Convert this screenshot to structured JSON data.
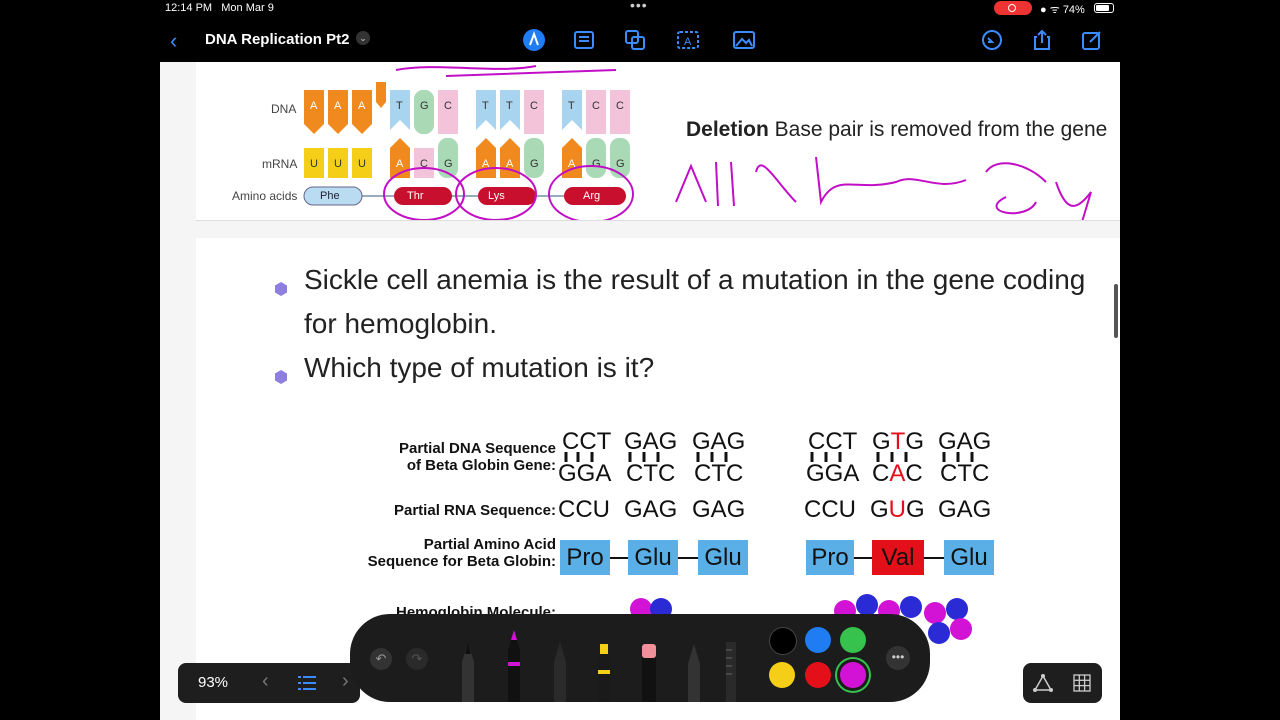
{
  "status": {
    "time": "12:14 PM",
    "date": "Mon Mar 9",
    "battery": "74%"
  },
  "toolbar": {
    "title": "DNA Replication Pt2"
  },
  "slide1": {
    "dna_label": "DNA",
    "mrna_label": "mRNA",
    "aa_label": "Amino acids",
    "dna_bases": [
      "A",
      "A",
      "A",
      "T",
      "G",
      "C",
      "T",
      "T",
      "C",
      "T",
      "C",
      "C"
    ],
    "mrna_bases": [
      "U",
      "U",
      "U",
      "A",
      "C",
      "G",
      "A",
      "A",
      "G",
      "A",
      "G",
      "G"
    ],
    "amino_acids": [
      "Phe",
      "Thr",
      "Lys",
      "Arg"
    ],
    "deletion_bold": "Deletion",
    "deletion_text": " Base pair is removed from the gene"
  },
  "slide2": {
    "bullet1_line1": "Sickle cell anemia is the result of a mutation in the gene coding",
    "bullet1_line2": "for hemoglobin.",
    "bullet2": "Which type of mutation is it?",
    "label_dna1": "Partial DNA Sequence",
    "label_dna2": "of Beta Globin Gene:",
    "label_rna": "Partial RNA Sequence:",
    "label_aa1": "Partial Amino Acid",
    "label_aa2": "Sequence for Beta Globin:",
    "label_hb": "Hemoglobin Molecule:",
    "normal_top": [
      "CCT",
      "GAG",
      "GAG"
    ],
    "normal_bottom": [
      "GGA",
      "CTC",
      "CTC"
    ],
    "normal_rna": [
      "CCU",
      "GAG",
      "GAG"
    ],
    "normal_aa": [
      "Pro",
      "Glu",
      "Glu"
    ],
    "mut_top": [
      "CCT",
      "GTG",
      "GAG"
    ],
    "mut_bottom": [
      "GGA",
      "CAC",
      "CTC"
    ],
    "mut_rna": [
      "CCU",
      "GUG",
      "GAG"
    ],
    "mut_aa": [
      "Pro",
      "Val",
      "Glu"
    ]
  },
  "bottombar": {
    "zoom": "93%"
  },
  "palette": {
    "colors": [
      "#000000",
      "#1f7cf2",
      "#36c24d",
      "#f5cf17",
      "#e3101a",
      "#d213d6"
    ]
  }
}
